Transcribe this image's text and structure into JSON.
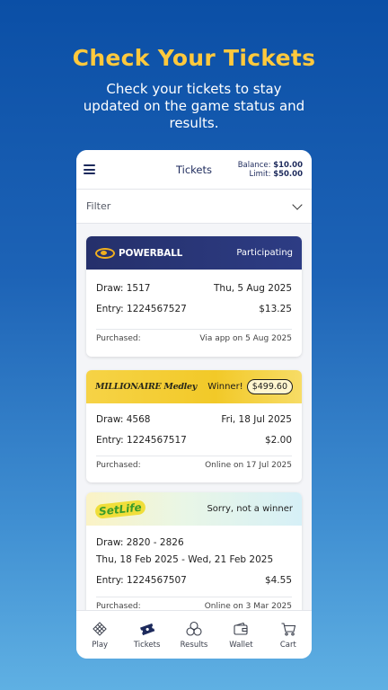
{
  "hero": {
    "title": "Check Your Tickets",
    "subtitle": "Check your tickets to stay updated on the game status and results."
  },
  "app": {
    "title": "Tickets",
    "balance_label": "Balance:",
    "balance_value": "$10.00",
    "limit_label": "Limit:",
    "limit_value": "$50.00",
    "filter_label": "Filter"
  },
  "tickets": [
    {
      "game": "POWERBALL",
      "status": "Participating",
      "draw": "Draw: 1517",
      "draw_date": "Thu, 5 Aug 2025",
      "entry": "Entry: 1224567527",
      "amount": "$13.25",
      "purchased_label": "Purchased:",
      "purchased_value": "Via app on 5 Aug 2025"
    },
    {
      "game": "MILLIONAIRE Medley",
      "status": "Winner!",
      "prize": "$499.60",
      "draw": "Draw: 4568",
      "draw_date": "Fri, 18 Jul 2025",
      "entry": "Entry: 1224567517",
      "amount": "$2.00",
      "purchased_label": "Purchased:",
      "purchased_value": "Online on 17 Jul 2025"
    },
    {
      "game": "SetLife",
      "status": "Sorry, not a winner",
      "draw": "Draw: 2820 - 2826",
      "draw_date": "Thu, 18 Feb 2025 - Wed, 21 Feb 2025",
      "entry": "Entry: 1224567507",
      "amount": "$4.55",
      "purchased_label": "Purchased:",
      "purchased_value": "Online on 3 Mar 2025"
    }
  ],
  "nav": [
    {
      "label": "Play",
      "icon": "play-grid-icon"
    },
    {
      "label": "Tickets",
      "icon": "ticket-icon"
    },
    {
      "label": "Results",
      "icon": "results-balls-icon"
    },
    {
      "label": "Wallet",
      "icon": "wallet-icon"
    },
    {
      "label": "Cart",
      "icon": "cart-icon"
    }
  ],
  "colors": {
    "accent_title": "#ffc93d",
    "brand_navy": "#1d2a5c",
    "powerball_header": "#2d3c84",
    "medley_header": "#f2c928"
  }
}
